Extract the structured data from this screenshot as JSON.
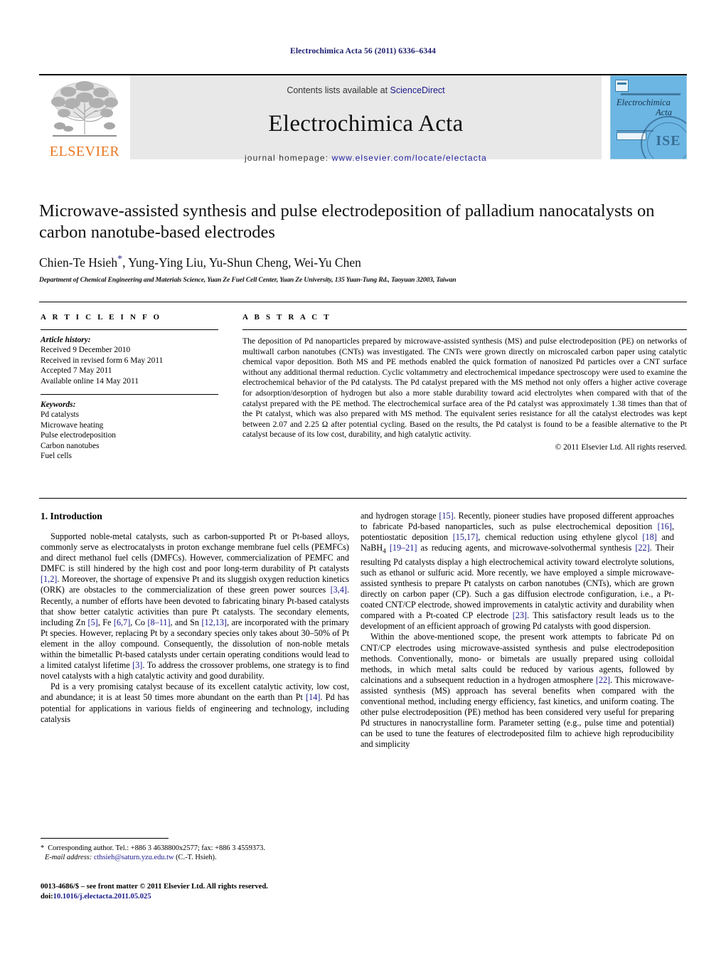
{
  "running_head": "Electrochimica Acta 56 (2011) 6336–6344",
  "masthead": {
    "contents_prefix": "Contents lists available at ",
    "sciencedirect": "ScienceDirect",
    "journal_title": "Electrochimica Acta",
    "homepage_label": "journal homepage: ",
    "homepage_url": "www.elsevier.com/locate/electacta",
    "publisher": "ELSEVIER",
    "publisher_logo": "elsevier-tree-logo",
    "cover_title_line1": "Electrochimica",
    "cover_title_line2": "Acta",
    "cover_seal": "ISE"
  },
  "article": {
    "title": "Microwave-assisted synthesis and pulse electrodeposition of palladium nanocatalysts on carbon nanotube-based electrodes",
    "authors": "Chien-Te Hsieh",
    "authors_rest": ", Yung-Ying Liu, Yu-Shun Cheng, Wei-Yu Chen",
    "corresponding_marker": "*",
    "affiliation": "Department of Chemical Engineering and Materials Science, Yuan Ze Fuel Cell Center, Yuan Ze University, 135 Yuan-Tung Rd., Taoyuan 32003, Taiwan"
  },
  "article_info": {
    "heading": "A R T I C L E   I N F O",
    "history_label": "Article history:",
    "history": [
      "Received 9 December 2010",
      "Received in revised form 6 May 2011",
      "Accepted 7 May 2011",
      "Available online 14 May 2011"
    ],
    "keywords_label": "Keywords:",
    "keywords": [
      "Pd catalysts",
      "Microwave heating",
      "Pulse electrodeposition",
      "Carbon nanotubes",
      "Fuel cells"
    ]
  },
  "abstract": {
    "heading": "A B S T R A C T",
    "text": "The deposition of Pd nanoparticles prepared by microwave-assisted synthesis (MS) and pulse electrodeposition (PE) on networks of multiwall carbon nanotubes (CNTs) was investigated. The CNTs were grown directly on microscaled carbon paper using catalytic chemical vapor deposition. Both MS and PE methods enabled the quick formation of nanosized Pd particles over a CNT surface without any additional thermal reduction. Cyclic voltammetry and electrochemical impedance spectroscopy were used to examine the electrochemical behavior of the Pd catalysts. The Pd catalyst prepared with the MS method not only offers a higher active coverage for adsorption/desorption of hydrogen but also a more stable durability toward acid electrolytes when compared with that of the catalyst prepared with the PE method. The electrochemical surface area of the Pd catalyst was approximately 1.38 times than that of the Pt catalyst, which was also prepared with MS method. The equivalent series resistance for all the catalyst electrodes was kept between 2.07 and 2.25 Ω after potential cycling. Based on the results, the Pd catalyst is found to be a feasible alternative to the Pt catalyst because of its low cost, durability, and high catalytic activity.",
    "copyright": "© 2011 Elsevier Ltd. All rights reserved."
  },
  "body": {
    "section_number_title": "1.  Introduction",
    "left_paragraphs": [
      "Supported noble-metal catalysts, such as carbon-supported Pt or Pt-based alloys, commonly serve as electrocatalysts in proton exchange membrane fuel cells (PEMFCs) and direct methanol fuel cells (DMFCs). However, commercialization of PEMFC and DMFC is still hindered by the high cost and poor long-term durability of Pt catalysts [1,2]. Moreover, the shortage of expensive Pt and its sluggish oxygen reduction kinetics (ORK) are obstacles to the commercialization of these green power sources [3,4]. Recently, a number of efforts have been devoted to fabricating binary Pt-based catalysts that show better catalytic activities than pure Pt catalysts. The secondary elements, including Zn [5], Fe [6,7], Co [8–11], and Sn [12,13], are incorporated with the primary Pt species. However, replacing Pt by a secondary species only takes about 30–50% of Pt element in the alloy compound. Consequently, the dissolution of non-noble metals within the bimetallic Pt-based catalysts under certain operating conditions would lead to a limited catalyst lifetime [3]. To address the crossover problems, one strategy is to find novel catalysts with a high catalytic activity and good durability.",
      "Pd is a very promising catalyst because of its excellent catalytic activity, low cost, and abundance; it is at least 50 times more abundant on the earth than Pt [14]. Pd has potential for applications in various fields of engineering and technology, including catalysis"
    ],
    "right_paragraphs": [
      "and hydrogen storage [15]. Recently, pioneer studies have proposed different approaches to fabricate Pd-based nanoparticles, such as pulse electrochemical deposition [16], potentiostatic deposition [15,17], chemical reduction using ethylene glycol [18] and NaBH4 [19–21] as reducing agents, and microwave-solvothermal synthesis [22]. Their resulting Pd catalysts display a high electrochemical activity toward electrolyte solutions, such as ethanol or sulfuric acid. More recently, we have employed a simple microwave-assisted synthesis to prepare Pt catalysts on carbon nanotubes (CNTs), which are grown directly on carbon paper (CP). Such a gas diffusion electrode configuration, i.e., a Pt-coated CNT/CP electrode, showed improvements in catalytic activity and durability when compared with a Pt-coated CP electrode [23]. This satisfactory result leads us to the development of an efficient approach of growing Pd catalysts with good dispersion.",
      "Within the above-mentioned scope, the present work attempts to fabricate Pd on CNT/CP electrodes using microwave-assisted synthesis and pulse electrodeposition methods. Conventionally, mono- or bimetals are usually prepared using colloidal methods, in which metal salts could be reduced by various agents, followed by calcinations and a subsequent reduction in a hydrogen atmosphere [22]. This microwave-assisted synthesis (MS) approach has several benefits when compared with the conventional method, including energy efficiency, fast kinetics, and uniform coating. The other pulse electrodeposition (PE) method has been considered very useful for preparing Pd structures in nanocrystalline form. Parameter setting (e.g., pulse time and potential) can be used to tune the features of electrodeposited film to achieve high reproducibility and simplicity"
    ]
  },
  "footnote": {
    "marker": "*",
    "corresponding": "Corresponding author. Tel.: +886 3 4638800x2577; fax: +886 3 4559373.",
    "email_label": "E-mail address:",
    "email": "cthsieh@saturn.yzu.edu.tw",
    "email_suffix": "(C.-T. Hsieh)."
  },
  "issn": {
    "line1": "0013-4686/$ – see front matter © 2011 Elsevier Ltd. All rights reserved.",
    "doi_label": "doi:",
    "doi": "10.1016/j.electacta.2011.05.025"
  },
  "colors": {
    "link": "#1a1a8c",
    "elsevier_orange": "#E87722",
    "masthead_grey": "#e8e8e8",
    "cover_blue": "#6cb6e4"
  }
}
